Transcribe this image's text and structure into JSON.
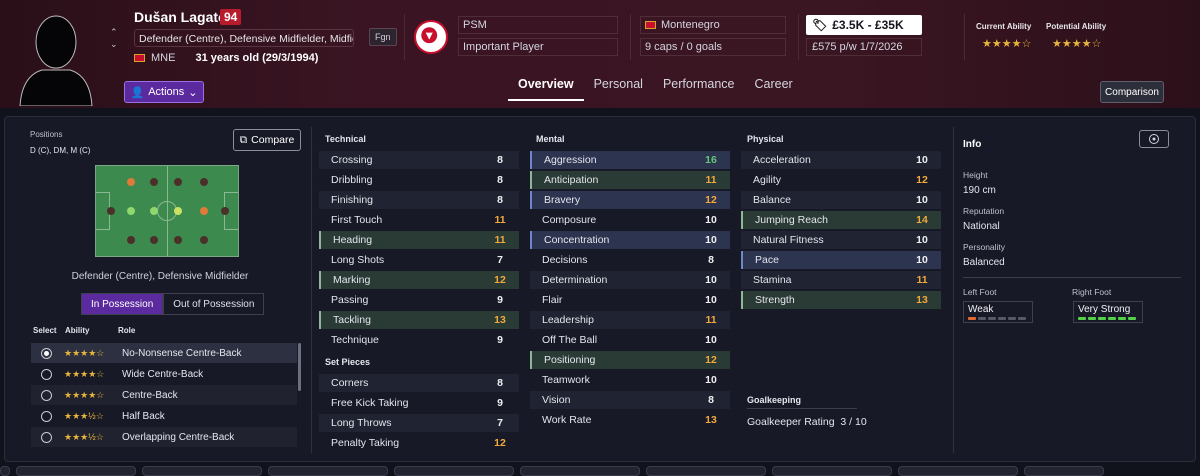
{
  "player": {
    "name": "Dušan Lagator",
    "ca_number": "94",
    "positions_text": "Defender (Centre), Defensive Midfielder, Midfiel...",
    "nationality_code": "MNE",
    "age_text": "31 years old (29/3/1994)",
    "foreign_badge": "Fgn",
    "actions_label": "Actions"
  },
  "club": {
    "name": "PSM",
    "role": "Important Player"
  },
  "nation": {
    "name": "Montenegro",
    "caps": "9 caps / 0 goals"
  },
  "value": {
    "range": "£3.5K - £35K",
    "wage": "£575 p/w",
    "contract": "1/7/2026"
  },
  "ability": {
    "current_label": "Current Ability",
    "potential_label": "Potential Ability",
    "current_stars": "★★★★☆",
    "potential_stars": "★★★★☆"
  },
  "tabs": [
    {
      "label": "Overview"
    },
    {
      "label": "Personal"
    },
    {
      "label": "Performance"
    },
    {
      "label": "Career"
    }
  ],
  "comparison_label": "Comparison",
  "positions": {
    "label": "Positions",
    "short": "D (C), DM, M (C)",
    "compare_label": "Compare",
    "role_title": "Defender (Centre), Defensive Midfielder",
    "in_possession": "In Possession",
    "out_possession": "Out of Possession",
    "col_select": "Select",
    "col_ability": "Ability",
    "col_role": "Role",
    "roles": [
      {
        "name": "No-Nonsense Centre-Back",
        "stars": "★★★★☆"
      },
      {
        "name": "Wide Centre-Back",
        "stars": "★★★★☆"
      },
      {
        "name": "Centre-Back",
        "stars": "★★★★☆"
      },
      {
        "name": "Half Back",
        "stars": "★★★½☆"
      },
      {
        "name": "Overlapping Centre-Back",
        "stars": "★★★½☆"
      }
    ]
  },
  "technical": {
    "title": "Technical",
    "items": [
      {
        "n": "Crossing",
        "v": "8"
      },
      {
        "n": "Dribbling",
        "v": "8"
      },
      {
        "n": "Finishing",
        "v": "8"
      },
      {
        "n": "First Touch",
        "v": "11"
      },
      {
        "n": "Heading",
        "v": "11"
      },
      {
        "n": "Long Shots",
        "v": "7"
      },
      {
        "n": "Marking",
        "v": "12"
      },
      {
        "n": "Passing",
        "v": "9"
      },
      {
        "n": "Tackling",
        "v": "13"
      },
      {
        "n": "Technique",
        "v": "9"
      }
    ]
  },
  "setpieces": {
    "title": "Set Pieces",
    "items": [
      {
        "n": "Corners",
        "v": "8"
      },
      {
        "n": "Free Kick Taking",
        "v": "9"
      },
      {
        "n": "Long Throws",
        "v": "7"
      },
      {
        "n": "Penalty Taking",
        "v": "12"
      }
    ]
  },
  "mental": {
    "title": "Mental",
    "items": [
      {
        "n": "Aggression",
        "v": "16"
      },
      {
        "n": "Anticipation",
        "v": "11"
      },
      {
        "n": "Bravery",
        "v": "12"
      },
      {
        "n": "Composure",
        "v": "10"
      },
      {
        "n": "Concentration",
        "v": "10"
      },
      {
        "n": "Decisions",
        "v": "8"
      },
      {
        "n": "Determination",
        "v": "10"
      },
      {
        "n": "Flair",
        "v": "10"
      },
      {
        "n": "Leadership",
        "v": "11"
      },
      {
        "n": "Off The Ball",
        "v": "10"
      },
      {
        "n": "Positioning",
        "v": "12"
      },
      {
        "n": "Teamwork",
        "v": "10"
      },
      {
        "n": "Vision",
        "v": "8"
      },
      {
        "n": "Work Rate",
        "v": "13"
      }
    ]
  },
  "physical": {
    "title": "Physical",
    "items": [
      {
        "n": "Acceleration",
        "v": "10"
      },
      {
        "n": "Agility",
        "v": "12"
      },
      {
        "n": "Balance",
        "v": "10"
      },
      {
        "n": "Jumping Reach",
        "v": "14"
      },
      {
        "n": "Natural Fitness",
        "v": "10"
      },
      {
        "n": "Pace",
        "v": "10"
      },
      {
        "n": "Stamina",
        "v": "11"
      },
      {
        "n": "Strength",
        "v": "13"
      }
    ]
  },
  "goalkeeping": {
    "title": "Goalkeeping",
    "rating_label": "Goalkeeper Rating",
    "rating_value": "3 / 10"
  },
  "info": {
    "title": "Info",
    "height_label": "Height",
    "height": "190 cm",
    "reputation_label": "Reputation",
    "reputation": "National",
    "personality_label": "Personality",
    "personality": "Balanced",
    "left_foot_label": "Left Foot",
    "left_foot": "Weak",
    "right_foot_label": "Right Foot",
    "right_foot": "Very Strong"
  }
}
